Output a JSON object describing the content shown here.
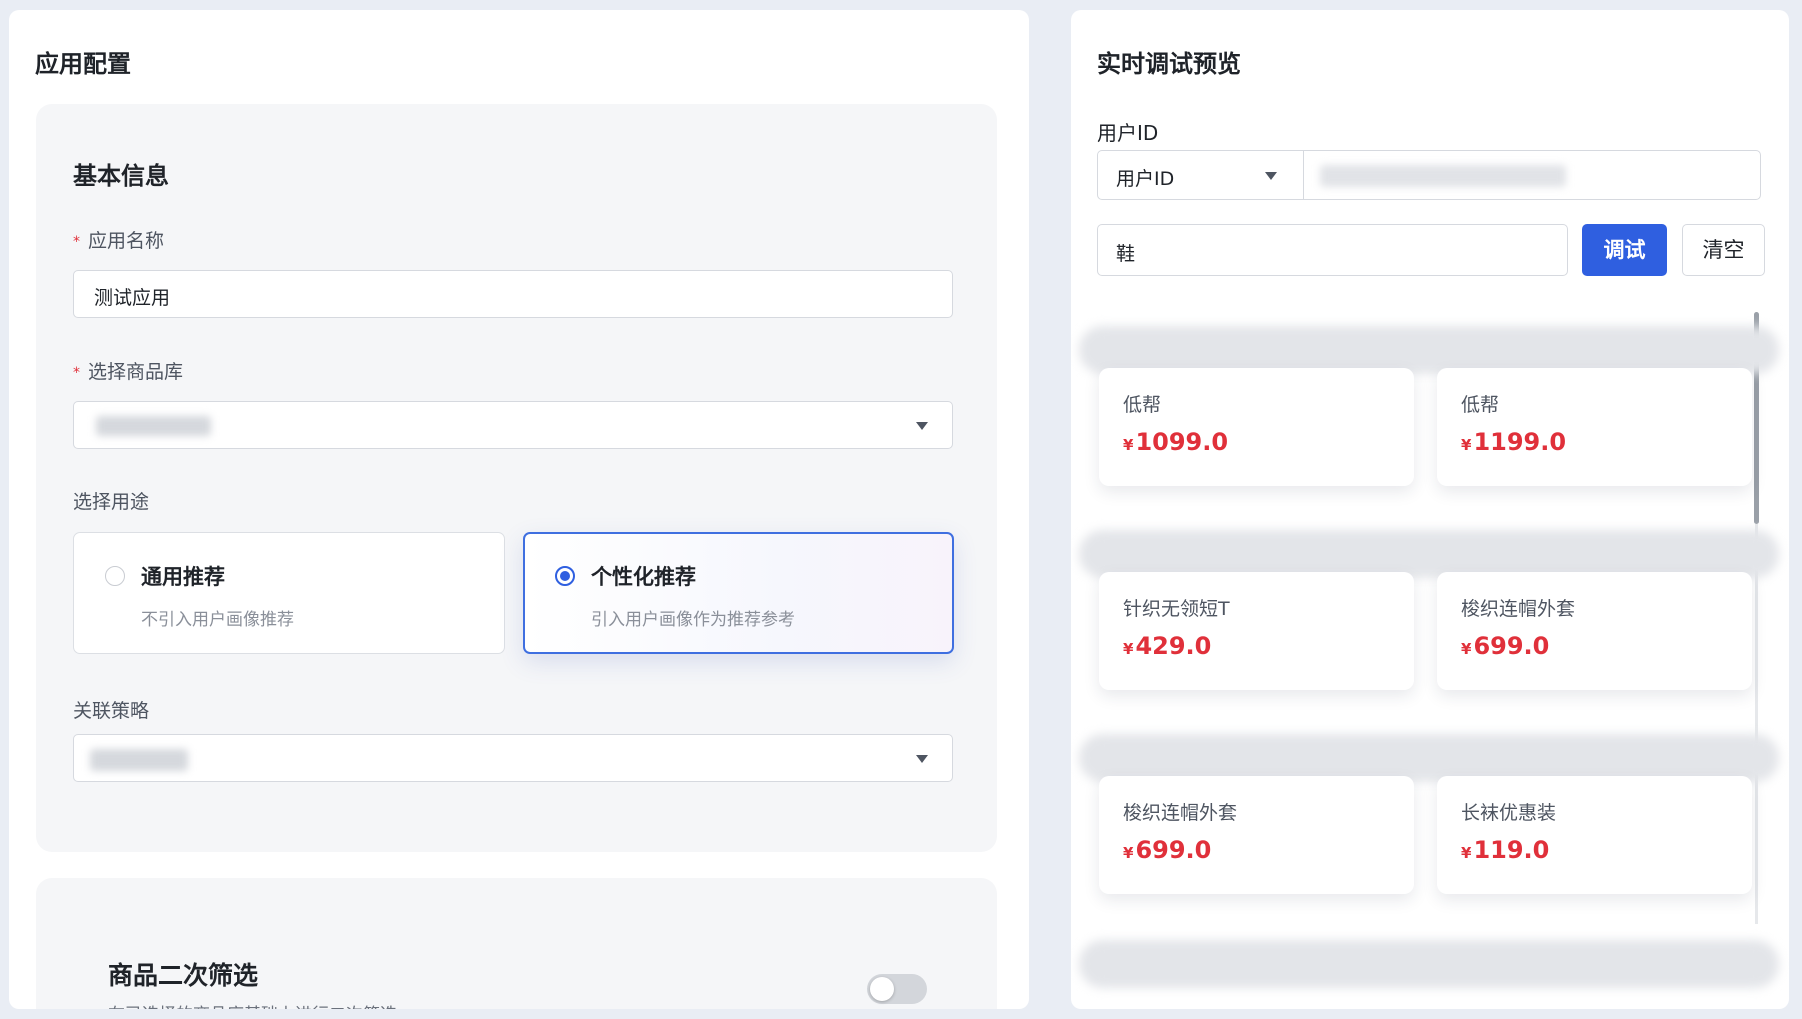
{
  "left": {
    "title": "应用配置",
    "basic": {
      "section_title": "基本信息",
      "app_name_label": "应用名称",
      "app_name_value": "测试应用",
      "product_lib_label": "选择商品库",
      "usage_label": "选择用途",
      "options": [
        {
          "title": "通用推荐",
          "desc": "不引入用户画像推荐",
          "selected": false
        },
        {
          "title": "个性化推荐",
          "desc": "引入用户画像作为推荐参考",
          "selected": true
        }
      ],
      "strategy_label": "关联策略"
    },
    "filter": {
      "title": "商品二次筛选",
      "desc": "在已选择的商品库基础上进行二次筛选",
      "enabled": false
    }
  },
  "right": {
    "title": "实时调试预览",
    "user_label": "用户ID",
    "user_select": "用户ID",
    "query_value": "鞋",
    "debug_button": "调试",
    "clear_button": "清空",
    "products": [
      {
        "name": "低帮",
        "price": "1099.0"
      },
      {
        "name": "低帮",
        "price": "1199.0"
      },
      {
        "name": "针织无领短T",
        "price": "429.0"
      },
      {
        "name": "梭织连帽外套",
        "price": "699.0"
      },
      {
        "name": "梭织连帽外套",
        "price": "699.0"
      },
      {
        "name": "长袜优惠装",
        "price": "119.0"
      }
    ],
    "currency": "¥"
  },
  "colors": {
    "accent": "#2f5fe0",
    "price": "#e0303a",
    "required": "#e0303a"
  }
}
